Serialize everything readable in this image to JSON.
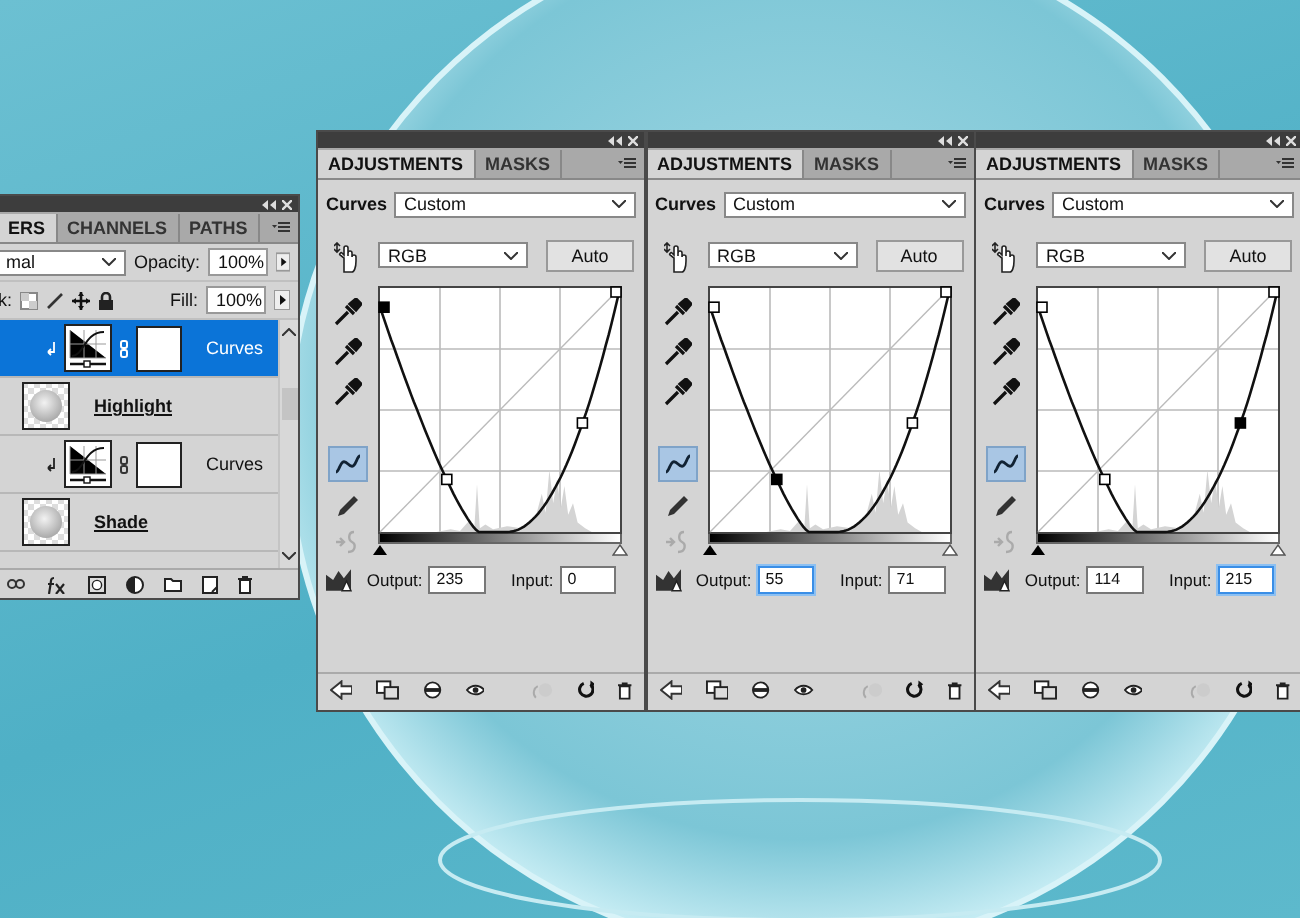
{
  "layers_panel": {
    "tabs": [
      {
        "label": "ERS",
        "selected": true
      },
      {
        "label": "CHANNELS",
        "selected": false
      },
      {
        "label": "PATHS",
        "selected": false
      }
    ],
    "blend_mode": "mal",
    "opacity_label": "Opacity:",
    "opacity": "100%",
    "lock_label": "k:",
    "fill_label": "Fill:",
    "fill": "100%",
    "layers": [
      {
        "kind": "adjustment",
        "name": "Curves",
        "selected": true
      },
      {
        "kind": "pixel",
        "name": "Highlight",
        "selected": false
      },
      {
        "kind": "adjustment",
        "name": "Curves",
        "selected": false
      },
      {
        "kind": "pixel",
        "name": "Shade",
        "selected": false
      }
    ]
  },
  "adjustment_panels": [
    {
      "tabs": [
        {
          "label": "ADJUSTMENTS",
          "selected": true
        },
        {
          "label": "MASKS",
          "selected": false
        }
      ],
      "type_label": "Curves",
      "preset": "Custom",
      "channel": "RGB",
      "auto_button": "Auto",
      "points": [
        {
          "selected": true
        },
        {
          "selected": false
        },
        {
          "selected": false
        },
        {
          "selected": false
        }
      ],
      "output": {
        "label": "Output:",
        "value": "235",
        "focused": false
      },
      "input": {
        "label": "Input:",
        "value": "0",
        "focused": false
      }
    },
    {
      "tabs": [
        {
          "label": "ADJUSTMENTS",
          "selected": true
        },
        {
          "label": "MASKS",
          "selected": false
        }
      ],
      "type_label": "Curves",
      "preset": "Custom",
      "channel": "RGB",
      "auto_button": "Auto",
      "points": [
        {
          "selected": false
        },
        {
          "selected": true
        },
        {
          "selected": false
        },
        {
          "selected": false
        }
      ],
      "output": {
        "label": "Output:",
        "value": "55",
        "focused": true
      },
      "input": {
        "label": "Input:",
        "value": "71",
        "focused": false
      }
    },
    {
      "tabs": [
        {
          "label": "ADJUSTMENTS",
          "selected": true
        },
        {
          "label": "MASKS",
          "selected": false
        }
      ],
      "type_label": "Curves",
      "preset": "Custom",
      "channel": "RGB",
      "auto_button": "Auto",
      "points": [
        {
          "selected": false
        },
        {
          "selected": false
        },
        {
          "selected": true
        },
        {
          "selected": false
        }
      ],
      "output": {
        "label": "Output:",
        "value": "114",
        "focused": false
      },
      "input": {
        "label": "Input:",
        "value": "215",
        "focused": true
      }
    }
  ]
}
